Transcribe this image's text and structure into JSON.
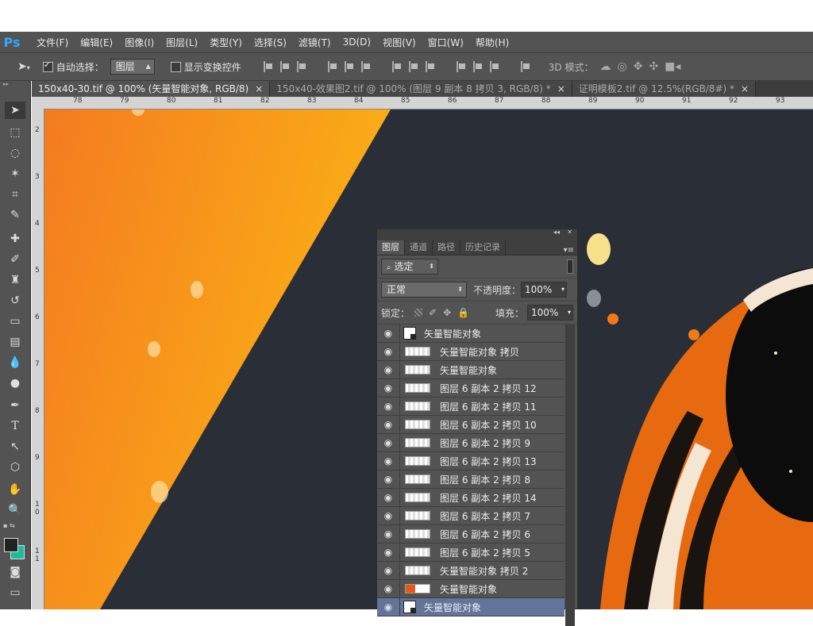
{
  "app": {
    "logo": "Ps"
  },
  "menu": [
    "文件(F)",
    "编辑(E)",
    "图像(I)",
    "图层(L)",
    "类型(Y)",
    "选择(S)",
    "滤镜(T)",
    "3D(D)",
    "视图(V)",
    "窗口(W)",
    "帮助(H)"
  ],
  "options": {
    "auto_select_label": "自动选择：",
    "auto_select_checked": true,
    "auto_select_target": "图层",
    "show_transform_label": "显示变换控件",
    "show_transform_checked": false,
    "mode_3d_label": "3D 模式："
  },
  "tabs": [
    {
      "title": "150x40-30.tif @ 100% (矢量智能对象, RGB/8)",
      "close": "×",
      "active": true
    },
    {
      "title": "150x40-效果图2.tif @ 100% (图层 9 副本 8 拷贝 3, RGB/8) *",
      "close": "×",
      "active": false
    },
    {
      "title": "证明模板2.tif @ 12.5%(RGB/8#) *",
      "close": "×",
      "active": false
    }
  ],
  "ruler_top": [
    "78",
    "79",
    "80",
    "81",
    "82",
    "83",
    "84",
    "85",
    "86",
    "87",
    "88",
    "89",
    "90",
    "91",
    "92",
    "93"
  ],
  "ruler_left": [
    "2",
    "3",
    "4",
    "5",
    "6",
    "7",
    "8",
    "9",
    "1 0",
    "1 1"
  ],
  "layers_panel": {
    "collapse": "◂◂",
    "close": "✕",
    "tabs": [
      "图层",
      "通道",
      "路径",
      "历史记录"
    ],
    "active_tab": "图层",
    "filter_label": "选定",
    "blend_mode": "正常",
    "opacity_label": "不透明度：",
    "opacity_value": "100%",
    "lock_label": "锁定：",
    "fill_label": "填充：",
    "fill_value": "100%",
    "layers": [
      {
        "name": "矢量智能对象",
        "kind": "smart",
        "selected": false
      },
      {
        "name": "矢量智能对象 拷贝",
        "kind": "raster",
        "selected": false
      },
      {
        "name": "矢量智能对象",
        "kind": "raster",
        "selected": false
      },
      {
        "name": "图层 6 副本 2 拷贝 12",
        "kind": "raster",
        "selected": false
      },
      {
        "name": "图层 6 副本 2 拷贝 11",
        "kind": "raster",
        "selected": false
      },
      {
        "name": "图层 6 副本 2 拷贝 10",
        "kind": "raster",
        "selected": false
      },
      {
        "name": "图层 6 副本 2 拷贝 9",
        "kind": "raster",
        "selected": false
      },
      {
        "name": "图层 6 副本 2 拷贝 13",
        "kind": "raster",
        "selected": false
      },
      {
        "name": "图层 6 副本 2 拷贝 8",
        "kind": "raster",
        "selected": false
      },
      {
        "name": "图层 6 副本 2 拷贝 14",
        "kind": "raster",
        "selected": false
      },
      {
        "name": "图层 6 副本 2 拷贝 7",
        "kind": "raster",
        "selected": false
      },
      {
        "name": "图层 6 副本 2 拷贝 6",
        "kind": "raster",
        "selected": false
      },
      {
        "name": "图层 6 副本 2 拷贝 5",
        "kind": "raster",
        "selected": false
      },
      {
        "name": "矢量智能对象 拷贝 2",
        "kind": "raster",
        "selected": false
      },
      {
        "name": "矢量智能对象",
        "kind": "raster",
        "selected": false
      },
      {
        "name": "矢量智能对象",
        "kind": "smart",
        "selected": true
      }
    ]
  },
  "colors": {
    "ui_bg": "#535353",
    "canvas_bg": "#2a2e37",
    "orange": "#f7931e",
    "selected_layer": "#63749a"
  }
}
